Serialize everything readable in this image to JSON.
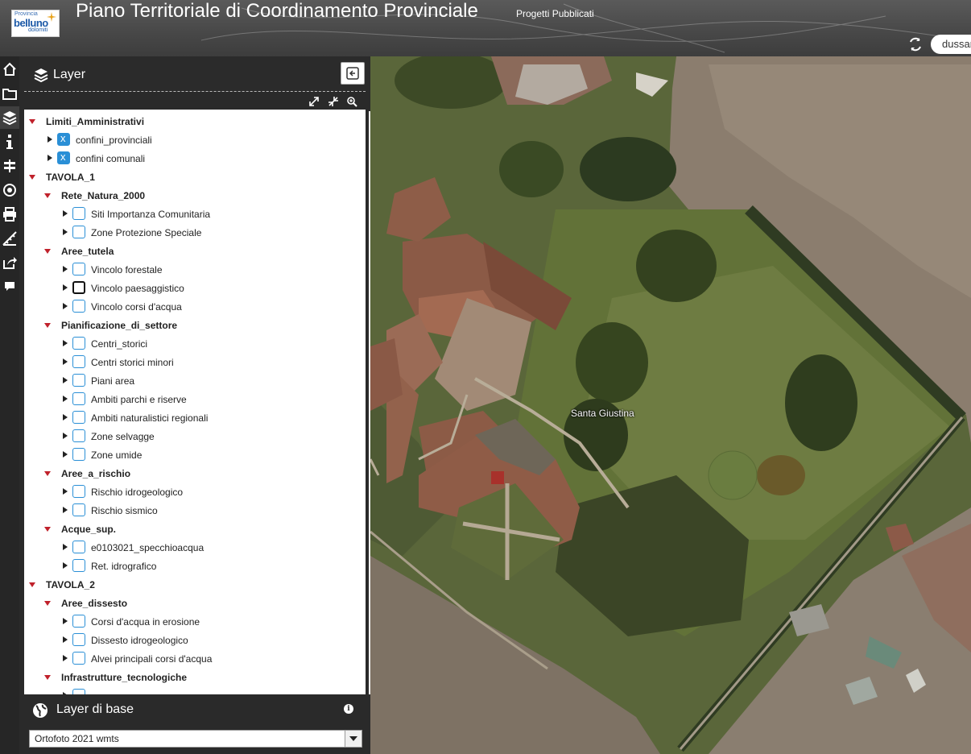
{
  "header": {
    "logo_small": "Provincia",
    "logo_main": "belluno",
    "logo_sub": "dolomiti",
    "title": "Piano Territoriale di Coordinamento Provinciale",
    "subtitle": "Progetti Pubblicati",
    "user_field": "dussan"
  },
  "toolbar": {
    "icons": [
      "home-icon",
      "folder-icon",
      "layers-icon",
      "info-icon",
      "signpost-icon",
      "target-icon",
      "print-icon",
      "ruler-icon",
      "share-icon",
      "comment-icon"
    ],
    "active": "layers-icon"
  },
  "panel": {
    "title": "Layer",
    "tree": [
      {
        "type": "group",
        "level": 0,
        "label": "Limiti_Amministrativi"
      },
      {
        "type": "layer",
        "level": 0,
        "label": "confini_provinciali",
        "checked": true
      },
      {
        "type": "layer",
        "level": 0,
        "label": "confini comunali",
        "checked": true
      },
      {
        "type": "group",
        "level": 0,
        "label": "TAVOLA_1"
      },
      {
        "type": "group",
        "level": 1,
        "label": "Rete_Natura_2000"
      },
      {
        "type": "layer",
        "level": 1,
        "label": "Siti Importanza Comunitaria",
        "checked": false
      },
      {
        "type": "layer",
        "level": 1,
        "label": "Zone Protezione Speciale",
        "checked": false
      },
      {
        "type": "group",
        "level": 1,
        "label": "Aree_tutela"
      },
      {
        "type": "layer",
        "level": 1,
        "label": "Vincolo forestale",
        "checked": false
      },
      {
        "type": "layer",
        "level": 1,
        "label": "Vincolo paesaggistico",
        "checked": false,
        "focused": true
      },
      {
        "type": "layer",
        "level": 1,
        "label": "Vincolo corsi d'acqua",
        "checked": false
      },
      {
        "type": "group",
        "level": 1,
        "label": "Pianificazione_di_settore"
      },
      {
        "type": "layer",
        "level": 1,
        "label": "Centri_storici",
        "checked": false
      },
      {
        "type": "layer",
        "level": 1,
        "label": "Centri storici minori",
        "checked": false
      },
      {
        "type": "layer",
        "level": 1,
        "label": "Piani area",
        "checked": false
      },
      {
        "type": "layer",
        "level": 1,
        "label": "Ambiti parchi e riserve",
        "checked": false
      },
      {
        "type": "layer",
        "level": 1,
        "label": "Ambiti naturalistici regionali",
        "checked": false
      },
      {
        "type": "layer",
        "level": 1,
        "label": "Zone selvagge",
        "checked": false
      },
      {
        "type": "layer",
        "level": 1,
        "label": "Zone umide",
        "checked": false
      },
      {
        "type": "group",
        "level": 1,
        "label": "Aree_a_rischio"
      },
      {
        "type": "layer",
        "level": 1,
        "label": "Rischio idrogeologico",
        "checked": false
      },
      {
        "type": "layer",
        "level": 1,
        "label": "Rischio sismico",
        "checked": false
      },
      {
        "type": "group",
        "level": 1,
        "label": "Acque_sup."
      },
      {
        "type": "layer",
        "level": 1,
        "label": "e0103021_specchioacqua",
        "checked": false
      },
      {
        "type": "layer",
        "level": 1,
        "label": "Ret. idrografico",
        "checked": false
      },
      {
        "type": "group",
        "level": 0,
        "label": "TAVOLA_2"
      },
      {
        "type": "group",
        "level": 1,
        "label": "Aree_dissesto"
      },
      {
        "type": "layer",
        "level": 1,
        "label": "Corsi d'acqua in erosione",
        "checked": false
      },
      {
        "type": "layer",
        "level": 1,
        "label": "Dissesto idrogeologico",
        "checked": false
      },
      {
        "type": "layer",
        "level": 1,
        "label": "Alvei principali corsi d'acqua",
        "checked": false
      },
      {
        "type": "group",
        "level": 1,
        "label": "Infrastrutture_tecnologiche"
      },
      {
        "type": "layer",
        "level": 1,
        "label": "",
        "checked": false
      }
    ]
  },
  "base_layer": {
    "title": "Layer di base",
    "info_icon": "i",
    "selected": "Ortofoto 2021 wmts"
  },
  "map": {
    "place_label": "Santa Giustina",
    "marker_color": "#a8312b"
  }
}
